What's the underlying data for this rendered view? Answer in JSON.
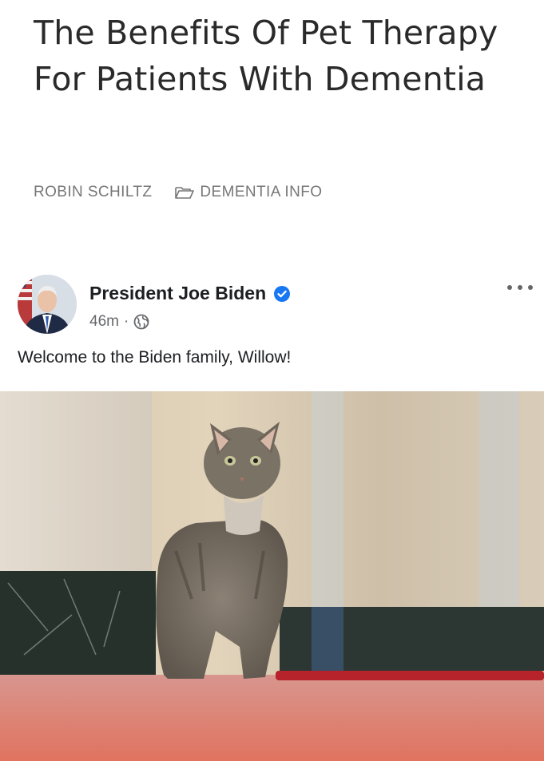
{
  "article": {
    "title": "The Benefits Of Pet Therapy For Patients With Dementia",
    "author": "ROBIN SCHILTZ",
    "category": "DEMENTIA INFO",
    "category_icon": "folder-icon"
  },
  "post": {
    "author_name": "President Joe Biden",
    "verified_icon": "verified-badge-icon",
    "verified_color": "#1877f2",
    "time": "46m",
    "separator": "·",
    "privacy_icon": "globe-icon",
    "more_icon": "more-options-icon",
    "text": "Welcome to the Biden family, Willow!",
    "image_subject": "gray tabby cat"
  }
}
